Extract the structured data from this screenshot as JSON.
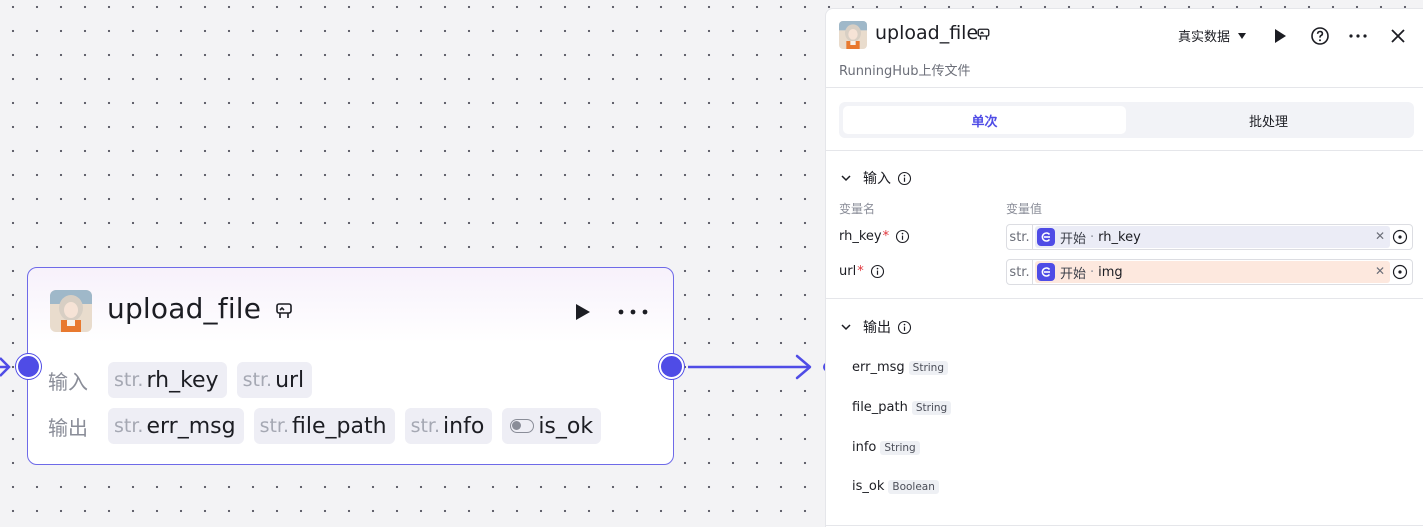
{
  "node": {
    "title": "upload_file",
    "input_label": "输入",
    "output_label": "输出",
    "inputs": [
      {
        "type": "str.",
        "name": "rh_key"
      },
      {
        "type": "str.",
        "name": "url"
      }
    ],
    "outputs": [
      {
        "type": "str.",
        "name": "err_msg"
      },
      {
        "type": "str.",
        "name": "file_path"
      },
      {
        "type": "str.",
        "name": "info"
      },
      {
        "type": "toggle",
        "name": "is_ok"
      }
    ]
  },
  "panel": {
    "title": "upload_file",
    "subtitle": "RunningHub上传文件",
    "mode_label": "真实数据",
    "tabs": [
      {
        "label": "单次",
        "active": true
      },
      {
        "label": "批处理",
        "active": false
      }
    ],
    "input_section": {
      "title": "输入",
      "col_name": "变量名",
      "col_value": "变量值",
      "rows": [
        {
          "name": "rh_key",
          "required": "*",
          "type": "str.",
          "source": "开始",
          "dot": "·",
          "ref": "rh_key",
          "highlight": "blue"
        },
        {
          "name": "url",
          "required": "*",
          "type": "str.",
          "source": "开始",
          "dot": "·",
          "ref": "img",
          "highlight": "peach"
        }
      ]
    },
    "output_section": {
      "title": "输出",
      "rows": [
        {
          "name": "err_msg",
          "type": "String"
        },
        {
          "name": "file_path",
          "type": "String"
        },
        {
          "name": "info",
          "type": "String"
        },
        {
          "name": "is_ok",
          "type": "Boolean"
        }
      ]
    }
  },
  "colors": {
    "accent": "#4f4ce6",
    "required": "#e0343a",
    "canvas": "#f3f3f5"
  },
  "icons": [
    "avatar-image",
    "database-icon",
    "play-icon",
    "more-icon",
    "help-icon",
    "close-icon",
    "chevron-down-icon",
    "info-icon",
    "target-icon",
    "start-flag-icon"
  ]
}
